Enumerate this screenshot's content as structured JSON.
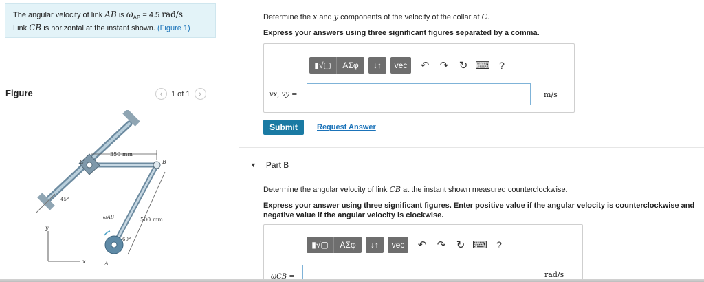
{
  "problem": {
    "line1_pre": "The angular velocity of link ",
    "line1_link": "AB",
    "line1_mid": " is ",
    "line1_omega": "ω",
    "line1_sub": "AB",
    "line1_val": " = 4.5 ",
    "line1_unit": "rad/s",
    "line1_end": " .",
    "line2_pre": "Link ",
    "line2_link": "CB",
    "line2_post": " is horizontal at the instant shown. ",
    "figure_link": "(Figure 1)"
  },
  "figure": {
    "title": "Figure",
    "pager_text": "1 of 1",
    "prev": "‹",
    "next": "›",
    "labels": {
      "dim_cb": "350 mm",
      "dim_ab": "500 mm",
      "angle_collar": "45°",
      "angle_a": "60°",
      "omega": "ωAB",
      "point_c": "C",
      "point_b": "B",
      "point_a": "A",
      "axis_x": "x",
      "axis_y": "y"
    }
  },
  "partA": {
    "prompt_pre": "Determine the ",
    "var_x": "x",
    "prompt_mid": " and ",
    "var_y": "y",
    "prompt_post": " components of the velocity of the collar at ",
    "var_c": "C",
    "prompt_end": ".",
    "instruction": "Express your answers using three significant figures separated by a comma.",
    "eq_label": "vx, vy =",
    "unit": "m/s",
    "input_value": "",
    "submit": "Submit",
    "request": "Request Answer"
  },
  "toolbar": {
    "templates": "▮√▢",
    "greek": "ΑΣφ",
    "arrows": "↓↑",
    "vec": "vec",
    "undo": "↶",
    "redo": "↷",
    "reset": "↻",
    "keyboard": "⌨",
    "help": "?"
  },
  "partB": {
    "title": "Part B",
    "prompt_pre": "Determine the angular velocity of link ",
    "var_cb": "CB",
    "prompt_post": " at the instant shown measured counterclockwise.",
    "instruction": "Express your answer using three significant figures. Enter positive value if the angular velocity is counterclockwise and negative value if the angular velocity is clockwise.",
    "eq_label": "ωCB =",
    "unit": "rad/s",
    "input_value": ""
  }
}
